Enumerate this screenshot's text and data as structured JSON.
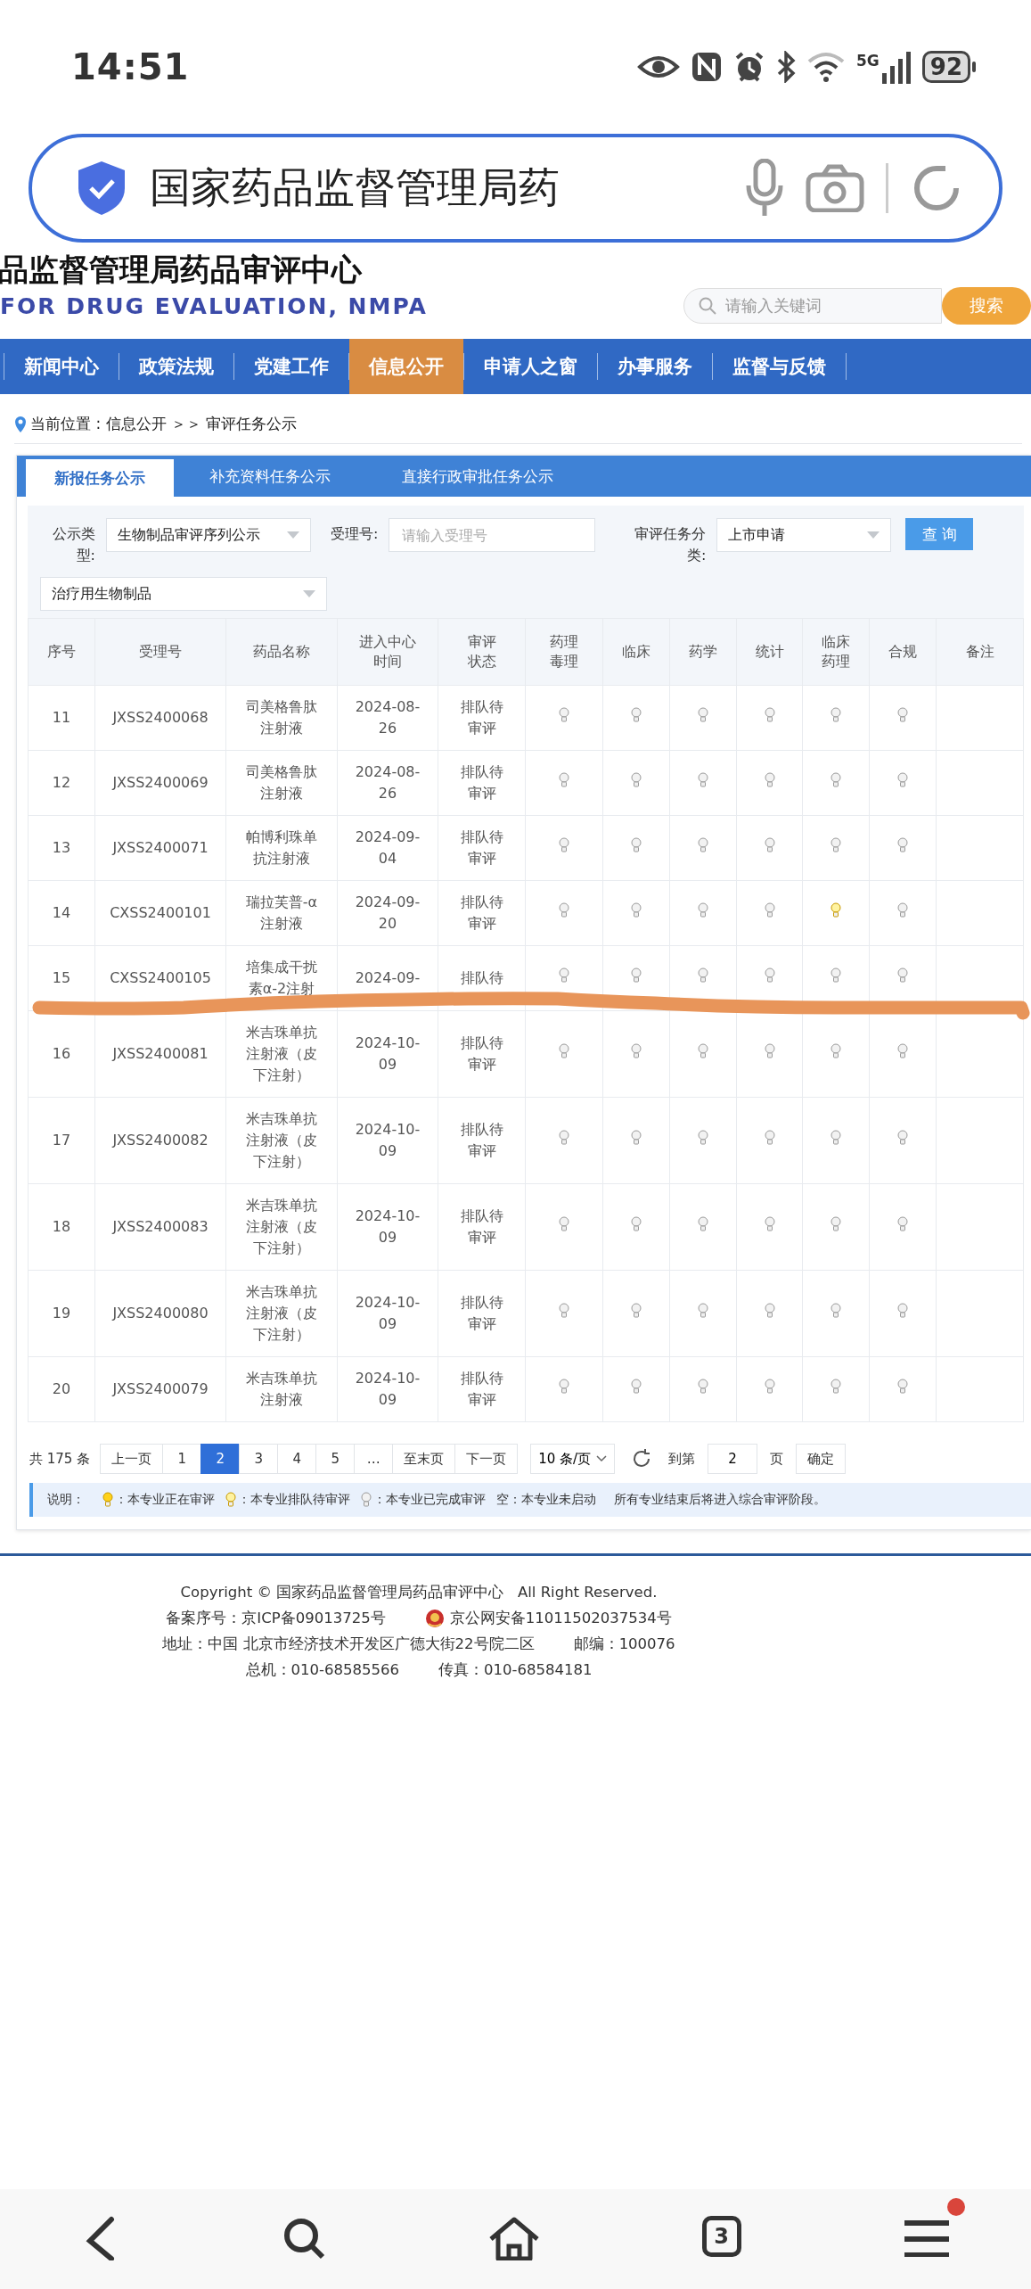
{
  "status_bar": {
    "time": "14:51",
    "network": "5G",
    "battery": "92"
  },
  "address_bar": {
    "title": "国家药品监督管理局药"
  },
  "site_header": {
    "title": "品监督管理局药品审评中心",
    "subtitle": "FOR DRUG EVALUATION, NMPA",
    "search": {
      "placeholder": "请输入关键词",
      "button": "搜索"
    }
  },
  "nav": [
    {
      "label": "新闻中心",
      "selected": false
    },
    {
      "label": "政策法规",
      "selected": false
    },
    {
      "label": "党建工作",
      "selected": false
    },
    {
      "label": "信息公开",
      "selected": true
    },
    {
      "label": "申请人之窗",
      "selected": false
    },
    {
      "label": "办事服务",
      "selected": false
    },
    {
      "label": "监督与反馈",
      "selected": false
    }
  ],
  "breadcrumb": "当前位置 : 信息公开 ＞＞ 审评任务公示",
  "tabs": [
    {
      "label": "新报任务公示",
      "selected": true
    },
    {
      "label": "补充资料任务公示",
      "selected": false
    },
    {
      "label": "直接行政审批任务公示",
      "selected": false
    }
  ],
  "filters": [
    {
      "kind": "select",
      "label": "公示类型:",
      "value": "生物制品审评序列公示"
    },
    {
      "kind": "input",
      "label": "受理号:",
      "placeholder": "请输入受理号"
    },
    {
      "kind": "select",
      "label": "审评任务分类:",
      "value": "上市申请"
    },
    {
      "kind": "button",
      "value": "查 询"
    },
    {
      "kind": "select",
      "value": "治疗用生物制品"
    }
  ],
  "table": {
    "columns": [
      "序号",
      "受理号",
      "药品名称",
      "进入中心时间",
      "审评状态",
      "药理毒理",
      "临床",
      "药学",
      "统计",
      "临床药理",
      "合规",
      "备注"
    ],
    "rows": [
      {
        "no": "11",
        "id": "JXSS2400068",
        "name": "司美格鲁肽注射液",
        "date": "2024-08-26",
        "status": "排队待审评",
        "bulbs": [
          {
            "color": "#f2f2f2"
          },
          {
            "color": "#f2f2f2"
          },
          {
            "color": "#f2f2f2"
          },
          {
            "color": "#f2f2f2"
          },
          {
            "color": "#f2f2f2"
          },
          {
            "color": "#f2f2f2"
          }
        ]
      },
      {
        "no": "12",
        "id": "JXSS2400069",
        "name": "司美格鲁肽注射液",
        "date": "2024-08-26",
        "status": "排队待审评",
        "bulbs": [
          {
            "color": "#f2f2f2"
          },
          {
            "color": "#f2f2f2"
          },
          {
            "color": "#f2f2f2"
          },
          {
            "color": "#f2f2f2"
          },
          {
            "color": "#f2f2f2"
          },
          {
            "color": "#f2f2f2"
          }
        ]
      },
      {
        "no": "13",
        "id": "JXSS2400071",
        "name": "帕博利珠单抗注射液",
        "date": "2024-09-04",
        "status": "排队待审评",
        "bulbs": [
          {
            "color": "#f2f2f2"
          },
          {
            "color": "#f2f2f2"
          },
          {
            "color": "#f2f2f2"
          },
          {
            "color": "#f2f2f2"
          },
          {
            "color": "#f2f2f2"
          },
          {
            "color": "#f2f2f2"
          }
        ]
      },
      {
        "no": "14",
        "id": "CXSS2400101",
        "name": "瑞拉芙普-α注射液",
        "date": "2024-09-20",
        "status": "排队待审评",
        "bulbs": [
          {
            "color": "#f2f2f2"
          },
          {
            "color": "#f2f2f2"
          },
          {
            "color": "#f2f2f2"
          },
          {
            "color": "#f2f2f2"
          },
          {
            "color": "#fff3a0"
          },
          {
            "color": "#f2f2f2"
          }
        ]
      },
      {
        "no": "15",
        "id": "CXSS2400105",
        "name": "培集成干扰素α-2注射",
        "date": "2024-09-",
        "status": "排队待",
        "bulbs": [
          {
            "color": "#f2f2f2"
          },
          {
            "color": "#f2f2f2"
          },
          {
            "color": "#f2f2f2"
          },
          {
            "color": "#f2f2f2"
          },
          {
            "color": "#f2f2f2"
          },
          {
            "color": "#f2f2f2"
          }
        ]
      },
      {
        "no": "16",
        "id": "JXSS2400081",
        "name": "米吉珠单抗注射液（皮下注射）",
        "date": "2024-10-09",
        "status": "排队待审评",
        "bulbs": [
          {
            "color": "#f2f2f2"
          },
          {
            "color": "#f2f2f2"
          },
          {
            "color": "#f2f2f2"
          },
          {
            "color": "#f2f2f2"
          },
          {
            "color": "#f2f2f2"
          },
          {
            "color": "#f2f2f2"
          }
        ]
      },
      {
        "no": "17",
        "id": "JXSS2400082",
        "name": "米吉珠单抗注射液（皮下注射）",
        "date": "2024-10-09",
        "status": "排队待审评",
        "bulbs": [
          {
            "color": "#f2f2f2"
          },
          {
            "color": "#f2f2f2"
          },
          {
            "color": "#f2f2f2"
          },
          {
            "color": "#f2f2f2"
          },
          {
            "color": "#f2f2f2"
          },
          {
            "color": "#f2f2f2"
          }
        ]
      },
      {
        "no": "18",
        "id": "JXSS2400083",
        "name": "米吉珠单抗注射液（皮下注射）",
        "date": "2024-10-09",
        "status": "排队待审评",
        "bulbs": [
          {
            "color": "#f2f2f2"
          },
          {
            "color": "#f2f2f2"
          },
          {
            "color": "#f2f2f2"
          },
          {
            "color": "#f2f2f2"
          },
          {
            "color": "#f2f2f2"
          },
          {
            "color": "#f2f2f2"
          }
        ]
      },
      {
        "no": "19",
        "id": "JXSS2400080",
        "name": "米吉珠单抗注射液（皮下注射）",
        "date": "2024-10-09",
        "status": "排队待审评",
        "bulbs": [
          {
            "color": "#f2f2f2"
          },
          {
            "color": "#f2f2f2"
          },
          {
            "color": "#f2f2f2"
          },
          {
            "color": "#f2f2f2"
          },
          {
            "color": "#f2f2f2"
          },
          {
            "color": "#f2f2f2"
          }
        ]
      },
      {
        "no": "20",
        "id": "JXSS2400079",
        "name": "米吉珠单抗注射液",
        "date": "2024-10-09",
        "status": "排队待审评",
        "bulbs": [
          {
            "color": "#f2f2f2"
          },
          {
            "color": "#f2f2f2"
          },
          {
            "color": "#f2f2f2"
          },
          {
            "color": "#f2f2f2"
          },
          {
            "color": "#f2f2f2"
          },
          {
            "color": "#f2f2f2"
          }
        ]
      }
    ]
  },
  "annotation": {
    "kind": "stroke"
  },
  "pagination": {
    "total": "共 175 条",
    "prev": "上一页",
    "pages": [
      {
        "label": "1",
        "selected": false
      },
      {
        "label": "2",
        "selected": true
      },
      {
        "label": "3",
        "selected": false
      },
      {
        "label": "4",
        "selected": false
      },
      {
        "label": "5",
        "selected": false
      }
    ],
    "ellipsis": "…",
    "last": "至末页",
    "next": "下一页",
    "page_size": "10 条/页",
    "goto_label": "到第",
    "goto_value": "2",
    "page_unit": "页",
    "confirm": "确定"
  },
  "legend": {
    "label": "说明：",
    "items": [
      {
        "color": "#ffd21a",
        "text": "：本专业正在审评"
      },
      {
        "color": "#fff3a0",
        "text": "：本专业排队待审评"
      },
      {
        "color": "#f2f2f2",
        "text": "：本专业已完成审评"
      }
    ],
    "empty_note": "空：本专业未启动",
    "final_note": "所有专业结束后将进入综合审评阶段。"
  },
  "footer": {
    "copyright": "Copyright © 国家药品监督管理局药品审评中心   All Right Reserved.",
    "icp": "备案序号：京ICP备09013725号",
    "police": "京公网安备11011502037534号",
    "address": "地址：中国 北京市经济技术开发区广德大街22号院二区",
    "postcode": "邮编：100076",
    "phone": "总机：010-68585566",
    "fax": "传真：010-68584181"
  },
  "bottom_nav": {
    "tab_count": "3",
    "badge": true
  }
}
